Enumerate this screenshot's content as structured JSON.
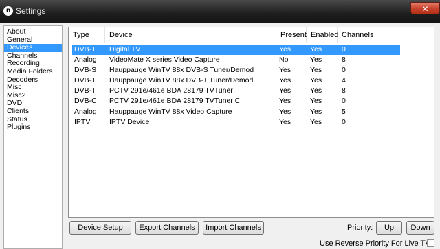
{
  "window": {
    "title": "Settings",
    "app_icon_glyph": "n",
    "close_glyph": "✕"
  },
  "sidebar": {
    "items": [
      "About",
      "General",
      "Devices",
      "Channels",
      "Recording",
      "Media Folders",
      "Decoders",
      "Misc",
      "Misc2",
      "DVD",
      "Clients",
      "Status",
      "Plugins"
    ],
    "selected": "Devices"
  },
  "table": {
    "headers": {
      "type": "Type",
      "device": "Device",
      "present": "Present",
      "enabled": "Enabled",
      "channels": "Channels"
    },
    "rows": [
      {
        "type": "DVB-T",
        "device": "Digital TV",
        "present": "Yes",
        "enabled": "Yes",
        "channels": "0"
      },
      {
        "type": "Analog",
        "device": "VideoMate X series Video Capture",
        "present": "No",
        "enabled": "Yes",
        "channels": "8"
      },
      {
        "type": "DVB-S",
        "device": "Hauppauge WinTV 88x DVB-S Tuner/Demod",
        "present": "Yes",
        "enabled": "Yes",
        "channels": "0"
      },
      {
        "type": "DVB-T",
        "device": "Hauppauge WinTV 88x DVB-T Tuner/Demod",
        "present": "Yes",
        "enabled": "Yes",
        "channels": "4"
      },
      {
        "type": "DVB-T",
        "device": "PCTV 291e/461e BDA 28179 TVTuner",
        "present": "Yes",
        "enabled": "Yes",
        "channels": "8"
      },
      {
        "type": "DVB-C",
        "device": "PCTV 291e/461e BDA 28179 TVTuner C",
        "present": "Yes",
        "enabled": "Yes",
        "channels": "0"
      },
      {
        "type": "Analog",
        "device": "Hauppauge WinTV 88x Video Capture",
        "present": "Yes",
        "enabled": "Yes",
        "channels": "5"
      },
      {
        "type": "IPTV",
        "device": "IPTV Device",
        "present": "Yes",
        "enabled": "Yes",
        "channels": "0"
      }
    ],
    "selected_index": 0
  },
  "buttons": {
    "device_setup": "Device Setup",
    "export_channels": "Export Channels",
    "import_channels": "Import Channels",
    "up": "Up",
    "down": "Down"
  },
  "priority": {
    "label": "Priority:",
    "reverse_label": "Use Reverse Priority For Live TV",
    "reverse_checked": false
  },
  "colors": {
    "selection": "#3399ff",
    "titlebar": "#1e1e1e",
    "close": "#c8432d"
  }
}
